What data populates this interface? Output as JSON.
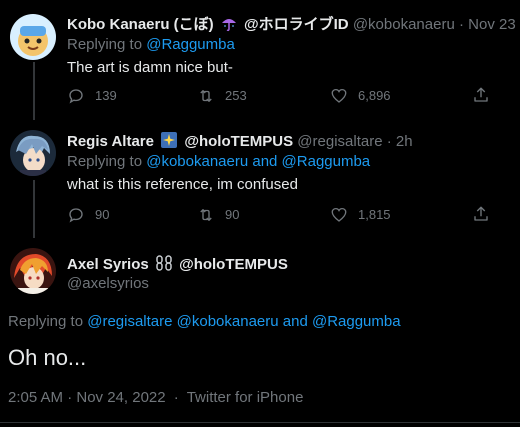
{
  "tweets": [
    {
      "display_name": "Kobo Kanaeru (こぼ)",
      "badge_emoji": "umbrella-icon",
      "tag": "@ホロライブID",
      "handle": "@kobokanaeru",
      "time": "Nov 23",
      "replying_prefix": "Replying to",
      "replying_to": "@Raggumba",
      "text": "The art is damn nice but-",
      "replies": "139",
      "retweets": "253",
      "likes": "6,896"
    },
    {
      "display_name": "Regis Altare",
      "badge_emoji": "sparkle-badge-icon",
      "tag": "@holoTEMPUS",
      "handle": "@regisaltare",
      "time": "2h",
      "replying_prefix": "Replying to",
      "replying_to": "@kobokanaeru and @Raggumba",
      "text": "what is this reference, im confused",
      "replies": "90",
      "retweets": "90",
      "likes": "1,815"
    }
  ],
  "main_tweet": {
    "display_name": "Axel Syrios",
    "badge_emoji": "chain-icon",
    "tag": "@holoTEMPUS",
    "handle": "@axelsyrios",
    "replying_prefix": "Replying to",
    "replying_to": "@regisaltare @kobokanaeru and @Raggumba",
    "text": "Oh no...",
    "timestamp": "2:05 AM · Nov 24, 2022",
    "source": "Twitter for iPhone"
  },
  "colors": {
    "background": "#000000",
    "text": "#e7e9ea",
    "muted": "#71767b",
    "link": "#1d9bf0"
  }
}
